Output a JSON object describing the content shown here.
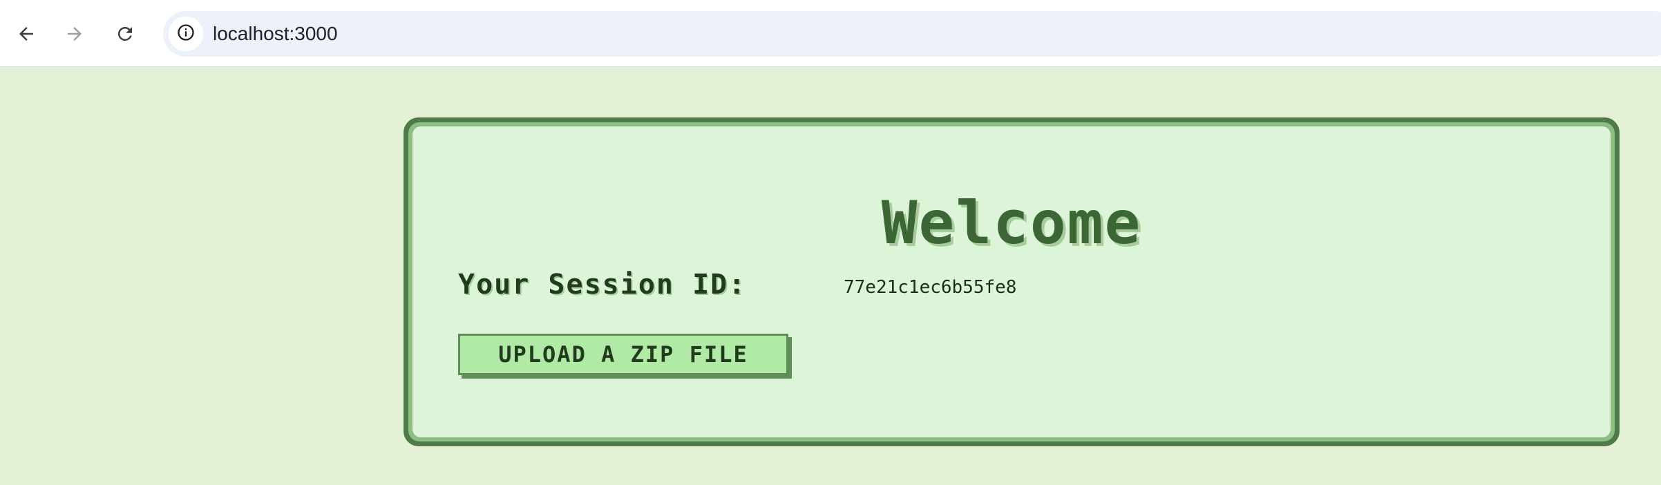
{
  "browser": {
    "url": "localhost:3000",
    "back_icon": "arrow-left-icon",
    "forward_icon": "arrow-right-icon",
    "reload_icon": "reload-icon",
    "site_info_icon": "info-icon"
  },
  "page": {
    "title": "Welcome",
    "session_label": "Your Session ID:",
    "session_id": "77e21c1ec6b55fe8",
    "upload_label": "UPLOAD A ZIP FILE"
  },
  "colors": {
    "page_background": "#e5f1d6",
    "card_background": "#dcf4d8",
    "card_border": "#4f7a4a",
    "accent": "#3d6636",
    "button_background": "#b1eaa7"
  }
}
